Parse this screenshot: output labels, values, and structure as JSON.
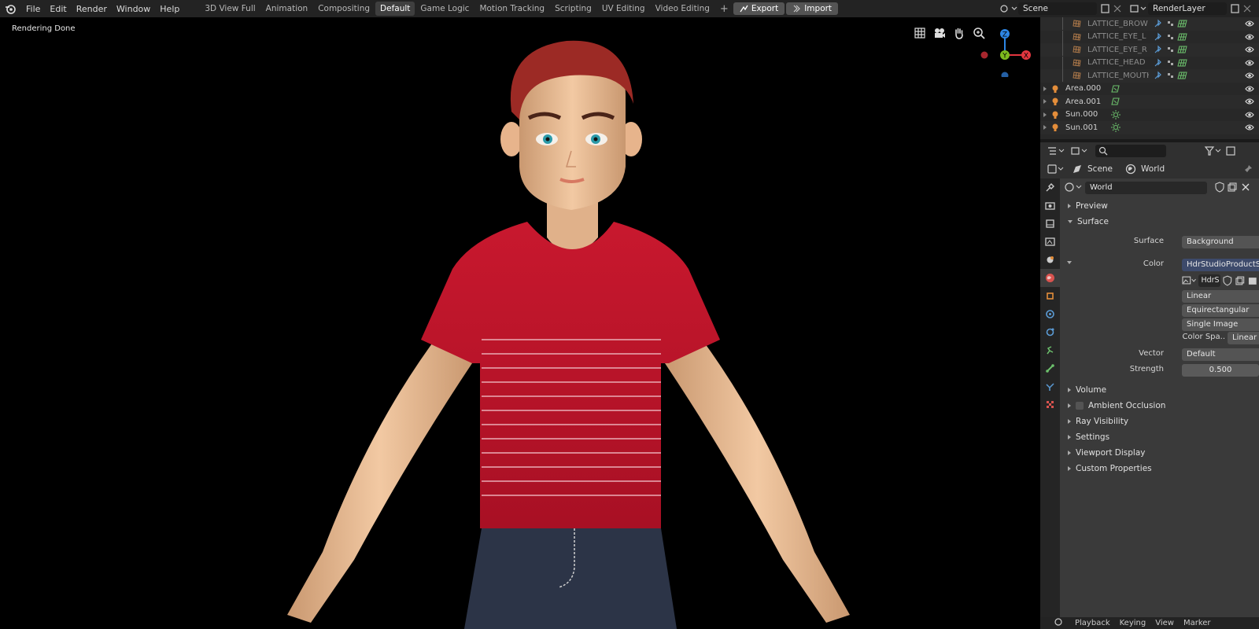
{
  "menu": [
    "File",
    "Edit",
    "Render",
    "Window",
    "Help"
  ],
  "workspaces": [
    {
      "label": "3D View Full",
      "active": false
    },
    {
      "label": "Animation",
      "active": false
    },
    {
      "label": "Compositing",
      "active": false
    },
    {
      "label": "Default",
      "active": true
    },
    {
      "label": "Game Logic",
      "active": false
    },
    {
      "label": "Motion Tracking",
      "active": false
    },
    {
      "label": "Scripting",
      "active": false
    },
    {
      "label": "UV Editing",
      "active": false
    },
    {
      "label": "Video Editing",
      "active": false
    }
  ],
  "add_workspace": "+",
  "export_label": "Export",
  "import_label": "Import",
  "scene_name": "Scene",
  "render_layer": "RenderLayer",
  "viewport": {
    "status": "Rendering Done",
    "gizmo": {
      "z": "Z",
      "y": "Y",
      "x": "X"
    },
    "colors": {
      "x": "#e2363f",
      "y": "#7cb91e",
      "z": "#2d86e5"
    }
  },
  "outliner": {
    "rows": [
      {
        "name": "LATTICE_BROW",
        "dim": true,
        "indent": 2,
        "icon": "lattice-icon"
      },
      {
        "name": "LATTICE_EYE_L",
        "dim": true,
        "indent": 2,
        "icon": "lattice-icon"
      },
      {
        "name": "LATTICE_EYE_R",
        "dim": true,
        "indent": 2,
        "icon": "lattice-icon"
      },
      {
        "name": "LATTICE_HEAD",
        "dim": true,
        "indent": 2,
        "icon": "lattice-icon"
      },
      {
        "name": "LATTICE_MOUTH",
        "dim": true,
        "indent": 2,
        "icon": "lattice-icon"
      },
      {
        "name": "Area.000",
        "dim": false,
        "indent": 1,
        "icon": "light-icon"
      },
      {
        "name": "Area.001",
        "dim": false,
        "indent": 1,
        "icon": "light-icon"
      },
      {
        "name": "Sun.000",
        "dim": false,
        "indent": 1,
        "icon": "sun-icon"
      },
      {
        "name": "Sun.001",
        "dim": false,
        "indent": 1,
        "icon": "sun-icon"
      }
    ]
  },
  "properties": {
    "breadcrumb_scene": "Scene",
    "breadcrumb_world": "World",
    "world_name": "World",
    "sections_top": [
      "Preview",
      "Surface"
    ],
    "surface_label": "Surface",
    "surface_value": "Background",
    "color_label": "Color",
    "color_value": "HdrStudioProductSof...",
    "image_name": "HdrS",
    "interpolation": "Linear",
    "projection": "Equirectangular",
    "source": "Single Image",
    "color_space_label": "Color Spa..",
    "color_space_value": "Linear",
    "vector_label": "Vector",
    "vector_value": "Default",
    "strength_label": "Strength",
    "strength_value": "0.500",
    "ambient_occlusion": "Ambient Occlusion",
    "sections_bottom": [
      "Volume",
      "Ambient Occlusion",
      "Ray Visibility",
      "Settings",
      "Viewport Display",
      "Custom Properties"
    ]
  },
  "timeline": [
    "Playback",
    "Keying",
    "View",
    "Marker"
  ]
}
